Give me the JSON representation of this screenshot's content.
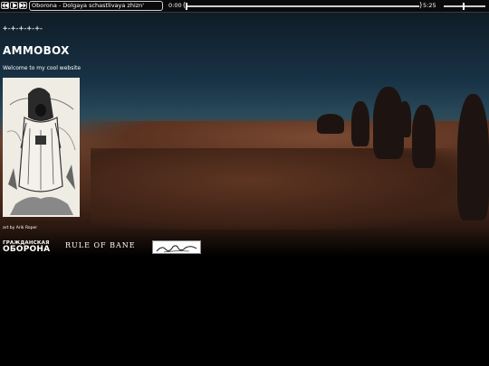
{
  "player": {
    "prev_icon": "rewind-icon",
    "play_icon": "play-icon",
    "next_icon": "fast-forward-icon",
    "track_title": "Oborona - Dolgaya schastlivaya zhizn'",
    "time_current": "0:00",
    "time_total": "5:25",
    "progress": 0,
    "volume": 0.48
  },
  "header": {
    "decoration": "+-+-+-+-+-",
    "site_title": "AMMOBOX",
    "welcome_text": "Welcome to my cool website"
  },
  "art": {
    "caption": "art by Arik Roper"
  },
  "logos": {
    "grazhdanskaya_line1": "ГРАЖДАНСКАЯ",
    "grazhdanskaya_line2": "ОБОРОНА",
    "blackletter_text": "RULE OF BANE",
    "signature_logo": "signature-logo"
  },
  "colors": {
    "background": "#000000",
    "sky": "#183246",
    "sand": "#5b3422",
    "ui_border": "#cfcfcf"
  }
}
